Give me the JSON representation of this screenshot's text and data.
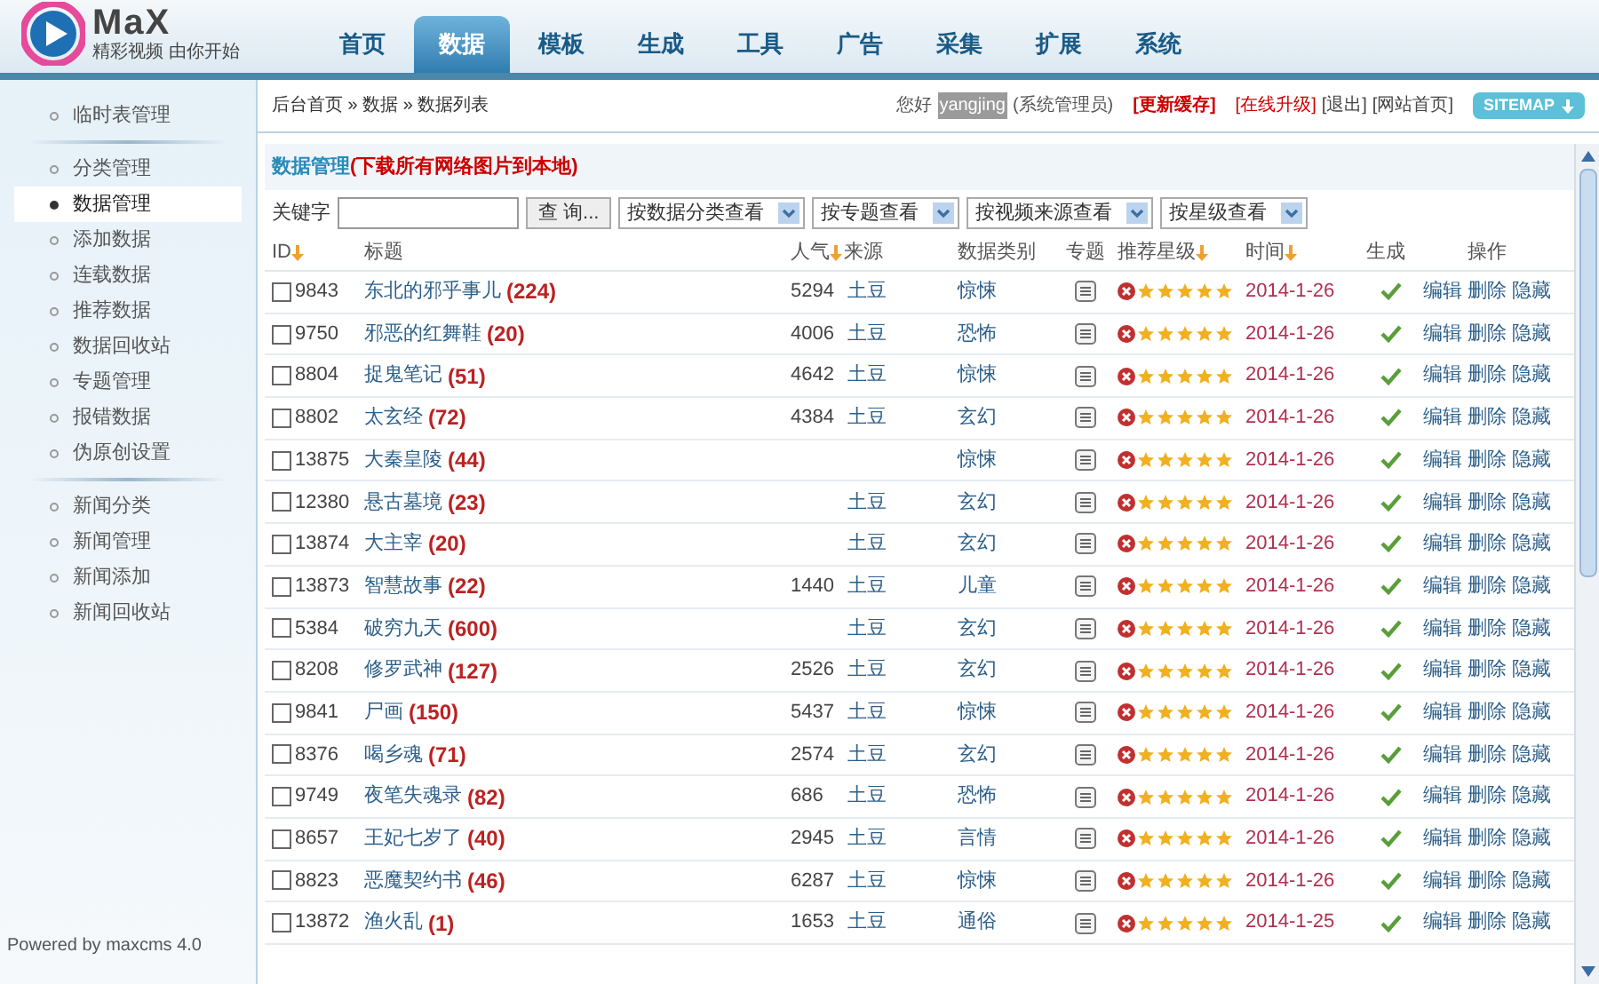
{
  "logo": {
    "wordmark": "MaX",
    "slogan": "精彩视频 由你开始"
  },
  "tabs": [
    {
      "label": "首页",
      "selected": false
    },
    {
      "label": "数据",
      "selected": true
    },
    {
      "label": "模板",
      "selected": false
    },
    {
      "label": "生成",
      "selected": false
    },
    {
      "label": "工具",
      "selected": false
    },
    {
      "label": "广告",
      "selected": false
    },
    {
      "label": "采集",
      "selected": false
    },
    {
      "label": "扩展",
      "selected": false
    },
    {
      "label": "系统",
      "selected": false
    }
  ],
  "breadcrumb": "后台首页 » 数据 » 数据列表",
  "user_bar": {
    "greeting": "您好",
    "username": "yangjing",
    "role": "(系统管理员)",
    "links": [
      {
        "label": "[更新缓存]",
        "kind": "strong"
      },
      {
        "label": "[在线升级]",
        "kind": "red"
      },
      {
        "label": "[退出]",
        "kind": "plain"
      },
      {
        "label": "[网站首页]",
        "kind": "plain"
      }
    ],
    "sitemap": "SITEMAP"
  },
  "sidebar": {
    "groups": [
      {
        "items": [
          {
            "label": "临时表管理",
            "selected": false
          }
        ]
      },
      {
        "items": [
          {
            "label": "分类管理",
            "selected": false
          },
          {
            "label": "数据管理",
            "selected": true
          },
          {
            "label": "添加数据",
            "selected": false
          },
          {
            "label": "连载数据",
            "selected": false
          },
          {
            "label": "推荐数据",
            "selected": false
          },
          {
            "label": "数据回收站",
            "selected": false
          },
          {
            "label": "专题管理",
            "selected": false
          },
          {
            "label": "报错数据",
            "selected": false
          },
          {
            "label": "伪原创设置",
            "selected": false
          }
        ]
      },
      {
        "items": [
          {
            "label": "新闻分类",
            "selected": false
          },
          {
            "label": "新闻管理",
            "selected": false
          },
          {
            "label": "新闻添加",
            "selected": false
          },
          {
            "label": "新闻回收站",
            "selected": false
          }
        ]
      }
    ],
    "footer": "Powered by maxcms 4.0"
  },
  "panel": {
    "title": "数据管理",
    "title_link": "(下载所有网络图片到本地)"
  },
  "filters": {
    "keyword_label": "关键字",
    "search_button": "查 询...",
    "selects": [
      "按数据分类查看",
      "按专题查看",
      "按视频来源查看",
      "按星级查看"
    ]
  },
  "table": {
    "columns": [
      {
        "label": "ID",
        "sortable": true
      },
      {
        "label": "标题",
        "sortable": false
      },
      {
        "label": "人气",
        "sortable": true
      },
      {
        "label": "来源",
        "sortable": false
      },
      {
        "label": "数据类别",
        "sortable": false
      },
      {
        "label": "专题",
        "sortable": false
      },
      {
        "label": "推荐星级",
        "sortable": true
      },
      {
        "label": "时间",
        "sortable": true
      },
      {
        "label": "生成",
        "sortable": false
      },
      {
        "label": "操作",
        "sortable": false
      }
    ],
    "rows": [
      {
        "id": "9843",
        "title": "东北的邪乎事儿",
        "count": "(224)",
        "hits": "5294",
        "source": "土豆",
        "category": "惊悚",
        "checked": false,
        "stars": 5,
        "date": "2014-1-26",
        "generated": true,
        "actions": [
          "编辑",
          "删除",
          "隐藏"
        ]
      },
      {
        "id": "9750",
        "title": "邪恶的红舞鞋",
        "count": "(20)",
        "hits": "4006",
        "source": "土豆",
        "category": "恐怖",
        "checked": false,
        "stars": 5,
        "date": "2014-1-26",
        "generated": true,
        "actions": [
          "编辑",
          "删除",
          "隐藏"
        ]
      },
      {
        "id": "8804",
        "title": "捉鬼笔记",
        "count": "(51)",
        "hits": "4642",
        "source": "土豆",
        "category": "惊悚",
        "checked": false,
        "stars": 5,
        "date": "2014-1-26",
        "generated": true,
        "actions": [
          "编辑",
          "删除",
          "隐藏"
        ]
      },
      {
        "id": "8802",
        "title": "太玄经",
        "count": "(72)",
        "hits": "4384",
        "source": "土豆",
        "category": "玄幻",
        "checked": false,
        "stars": 5,
        "date": "2014-1-26",
        "generated": true,
        "actions": [
          "编辑",
          "删除",
          "隐藏"
        ]
      },
      {
        "id": "13875",
        "title": "大秦皇陵",
        "count": "(44)",
        "category": "惊悚",
        "checked": false,
        "stars": 5,
        "date": "2014-1-26",
        "generated": true,
        "actions": [
          "编辑",
          "删除",
          "隐藏"
        ]
      },
      {
        "id": "12380",
        "title": "悬古墓境",
        "count": "(23)",
        "source": "土豆",
        "category": "玄幻",
        "checked": false,
        "stars": 5,
        "date": "2014-1-26",
        "generated": true,
        "actions": [
          "编辑",
          "删除",
          "隐藏"
        ]
      },
      {
        "id": "13874",
        "title": "大主宰",
        "count": "(20)",
        "source": "土豆",
        "category": "玄幻",
        "checked": false,
        "stars": 5,
        "date": "2014-1-26",
        "generated": true,
        "actions": [
          "编辑",
          "删除",
          "隐藏"
        ]
      },
      {
        "id": "13873",
        "title": "智慧故事",
        "count": "(22)",
        "hits": "1440",
        "source": "土豆",
        "category": "儿童",
        "checked": false,
        "stars": 5,
        "date": "2014-1-26",
        "generated": true,
        "actions": [
          "编辑",
          "删除",
          "隐藏"
        ]
      },
      {
        "id": "5384",
        "title": "破穷九天",
        "count": "(600)",
        "source": "土豆",
        "category": "玄幻",
        "checked": false,
        "stars": 5,
        "date": "2014-1-26",
        "generated": true,
        "actions": [
          "编辑",
          "删除",
          "隐藏"
        ]
      },
      {
        "id": "8208",
        "title": "修罗武神",
        "count": "(127)",
        "hits": "2526",
        "source": "土豆",
        "category": "玄幻",
        "checked": false,
        "stars": 5,
        "date": "2014-1-26",
        "generated": true,
        "actions": [
          "编辑",
          "删除",
          "隐藏"
        ]
      },
      {
        "id": "9841",
        "title": "尸画",
        "count": "(150)",
        "hits": "5437",
        "source": "土豆",
        "category": "惊悚",
        "checked": false,
        "stars": 5,
        "date": "2014-1-26",
        "generated": true,
        "actions": [
          "编辑",
          "删除",
          "隐藏"
        ]
      },
      {
        "id": "8376",
        "title": "喝乡魂",
        "count": "(71)",
        "hits": "2574",
        "source": "土豆",
        "category": "玄幻",
        "checked": false,
        "stars": 5,
        "date": "2014-1-26",
        "generated": true,
        "actions": [
          "编辑",
          "删除",
          "隐藏"
        ]
      },
      {
        "id": "9749",
        "title": "夜笔失魂录",
        "count": "(82)",
        "hits": "686",
        "source": "土豆",
        "category": "恐怖",
        "checked": false,
        "stars": 5,
        "date": "2014-1-26",
        "generated": true,
        "actions": [
          "编辑",
          "删除",
          "隐藏"
        ]
      },
      {
        "id": "8657",
        "title": "王妃七岁了",
        "count": "(40)",
        "hits": "2945",
        "source": "土豆",
        "category": "言情",
        "checked": false,
        "stars": 5,
        "date": "2014-1-26",
        "generated": true,
        "actions": [
          "编辑",
          "删除",
          "隐藏"
        ]
      },
      {
        "id": "8823",
        "title": "恶魔契约书",
        "count": "(46)",
        "hits": "6287",
        "source": "土豆",
        "category": "惊悚",
        "checked": false,
        "stars": 5,
        "date": "2014-1-26",
        "generated": true,
        "actions": [
          "编辑",
          "删除",
          "隐藏"
        ]
      },
      {
        "id": "13872",
        "title": "渔火乱",
        "count": "(1)",
        "hits": "1653",
        "source": "土豆",
        "category": "通俗",
        "checked": false,
        "stars": 5,
        "date": "2014-1-25",
        "generated": true,
        "actions": [
          "编辑",
          "删除",
          "隐藏"
        ]
      }
    ]
  }
}
